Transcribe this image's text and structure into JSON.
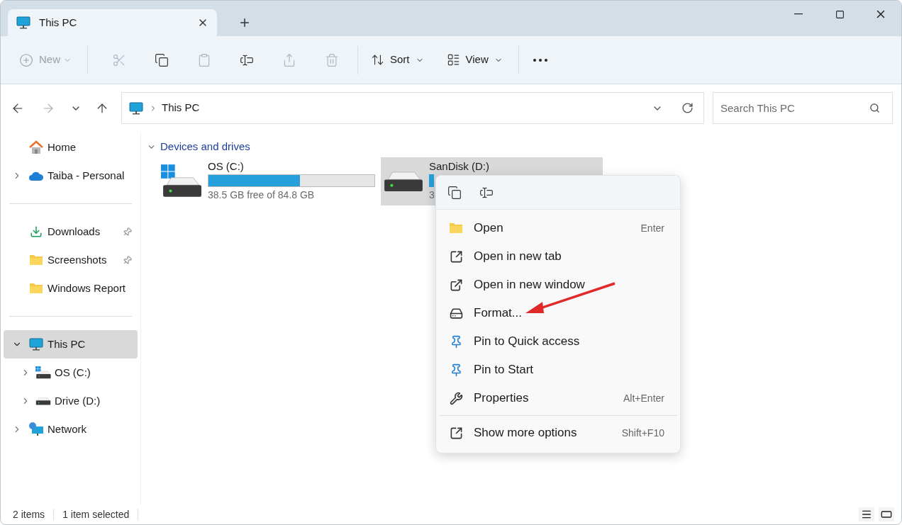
{
  "window": {
    "tabs": [
      {
        "title": "This PC",
        "selected": true
      }
    ]
  },
  "toolbar": {
    "new": {
      "label": "New",
      "disabled": true
    },
    "actions": [
      {
        "disabled": true
      },
      {
        "disabled": false
      },
      {
        "disabled": true
      },
      {
        "disabled": false
      },
      {
        "disabled": true
      },
      {
        "disabled": true
      }
    ],
    "sort": {
      "label": "Sort"
    },
    "view": {
      "label": "View"
    }
  },
  "navigation": {
    "back": {
      "disabled": false
    },
    "forward": {
      "disabled": true
    }
  },
  "address": {
    "path": [
      "This PC"
    ]
  },
  "search": {
    "placeholder": "Search This PC"
  },
  "sidebar": {
    "groups": [
      [
        {
          "label": "Home",
          "selected": false
        },
        {
          "label": "Taiba - Personal",
          "selected": false,
          "expanded": false
        }
      ],
      [
        {
          "label": "Downloads",
          "selected": false,
          "pinned": true
        },
        {
          "label": "Screenshots",
          "selected": false,
          "pinned": true
        },
        {
          "label": "Windows Report",
          "selected": false,
          "pinned": false
        }
      ],
      [
        {
          "label": "This PC",
          "selected": true,
          "expanded": true,
          "children": [
            {
              "label": "OS (C:)",
              "selected": false,
              "expanded": false
            },
            {
              "label": "Drive (D:)",
              "selected": false,
              "expanded": false
            }
          ]
        },
        {
          "label": "Network",
          "selected": false,
          "expanded": false
        }
      ]
    ]
  },
  "content": {
    "group": {
      "title": "Devices and drives",
      "expanded": true
    },
    "drives": [
      {
        "name": "OS (C:)",
        "level": 0.55,
        "free": "38.5 GB free of 84.8 GB",
        "selected": false
      },
      {
        "name": "SanDisk (D:)",
        "free": "3",
        "selected": true
      }
    ]
  },
  "context_menu": {
    "groups": [
      [
        {
          "label": "Open",
          "shortcut": "Enter"
        },
        {
          "label": "Open in new tab"
        },
        {
          "label": "Open in new window"
        },
        {
          "label": "Format..."
        },
        {
          "label": "Pin to Quick access"
        },
        {
          "label": "Pin to Start"
        },
        {
          "label": "Properties",
          "shortcut": "Alt+Enter"
        }
      ],
      [
        {
          "label": "Show more options",
          "shortcut": "Shift+F10"
        }
      ]
    ]
  },
  "status_bar": {
    "count": "2 items",
    "selection": "1 item selected"
  }
}
